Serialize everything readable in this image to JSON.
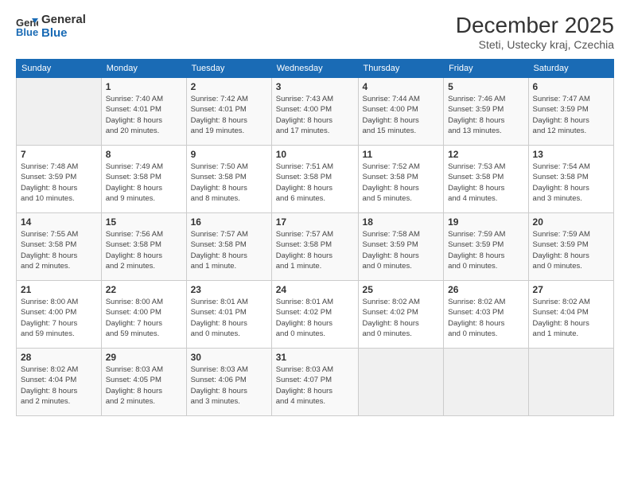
{
  "header": {
    "logo_line1": "General",
    "logo_line2": "Blue",
    "month_title": "December 2025",
    "location": "Steti, Ustecky kraj, Czechia"
  },
  "days_of_week": [
    "Sunday",
    "Monday",
    "Tuesday",
    "Wednesday",
    "Thursday",
    "Friday",
    "Saturday"
  ],
  "weeks": [
    [
      {
        "day": "",
        "detail": ""
      },
      {
        "day": "1",
        "detail": "Sunrise: 7:40 AM\nSunset: 4:01 PM\nDaylight: 8 hours\nand 20 minutes."
      },
      {
        "day": "2",
        "detail": "Sunrise: 7:42 AM\nSunset: 4:01 PM\nDaylight: 8 hours\nand 19 minutes."
      },
      {
        "day": "3",
        "detail": "Sunrise: 7:43 AM\nSunset: 4:00 PM\nDaylight: 8 hours\nand 17 minutes."
      },
      {
        "day": "4",
        "detail": "Sunrise: 7:44 AM\nSunset: 4:00 PM\nDaylight: 8 hours\nand 15 minutes."
      },
      {
        "day": "5",
        "detail": "Sunrise: 7:46 AM\nSunset: 3:59 PM\nDaylight: 8 hours\nand 13 minutes."
      },
      {
        "day": "6",
        "detail": "Sunrise: 7:47 AM\nSunset: 3:59 PM\nDaylight: 8 hours\nand 12 minutes."
      }
    ],
    [
      {
        "day": "7",
        "detail": "Sunrise: 7:48 AM\nSunset: 3:59 PM\nDaylight: 8 hours\nand 10 minutes."
      },
      {
        "day": "8",
        "detail": "Sunrise: 7:49 AM\nSunset: 3:58 PM\nDaylight: 8 hours\nand 9 minutes."
      },
      {
        "day": "9",
        "detail": "Sunrise: 7:50 AM\nSunset: 3:58 PM\nDaylight: 8 hours\nand 8 minutes."
      },
      {
        "day": "10",
        "detail": "Sunrise: 7:51 AM\nSunset: 3:58 PM\nDaylight: 8 hours\nand 6 minutes."
      },
      {
        "day": "11",
        "detail": "Sunrise: 7:52 AM\nSunset: 3:58 PM\nDaylight: 8 hours\nand 5 minutes."
      },
      {
        "day": "12",
        "detail": "Sunrise: 7:53 AM\nSunset: 3:58 PM\nDaylight: 8 hours\nand 4 minutes."
      },
      {
        "day": "13",
        "detail": "Sunrise: 7:54 AM\nSunset: 3:58 PM\nDaylight: 8 hours\nand 3 minutes."
      }
    ],
    [
      {
        "day": "14",
        "detail": "Sunrise: 7:55 AM\nSunset: 3:58 PM\nDaylight: 8 hours\nand 2 minutes."
      },
      {
        "day": "15",
        "detail": "Sunrise: 7:56 AM\nSunset: 3:58 PM\nDaylight: 8 hours\nand 2 minutes."
      },
      {
        "day": "16",
        "detail": "Sunrise: 7:57 AM\nSunset: 3:58 PM\nDaylight: 8 hours\nand 1 minute."
      },
      {
        "day": "17",
        "detail": "Sunrise: 7:57 AM\nSunset: 3:58 PM\nDaylight: 8 hours\nand 1 minute."
      },
      {
        "day": "18",
        "detail": "Sunrise: 7:58 AM\nSunset: 3:59 PM\nDaylight: 8 hours\nand 0 minutes."
      },
      {
        "day": "19",
        "detail": "Sunrise: 7:59 AM\nSunset: 3:59 PM\nDaylight: 8 hours\nand 0 minutes."
      },
      {
        "day": "20",
        "detail": "Sunrise: 7:59 AM\nSunset: 3:59 PM\nDaylight: 8 hours\nand 0 minutes."
      }
    ],
    [
      {
        "day": "21",
        "detail": "Sunrise: 8:00 AM\nSunset: 4:00 PM\nDaylight: 7 hours\nand 59 minutes."
      },
      {
        "day": "22",
        "detail": "Sunrise: 8:00 AM\nSunset: 4:00 PM\nDaylight: 7 hours\nand 59 minutes."
      },
      {
        "day": "23",
        "detail": "Sunrise: 8:01 AM\nSunset: 4:01 PM\nDaylight: 8 hours\nand 0 minutes."
      },
      {
        "day": "24",
        "detail": "Sunrise: 8:01 AM\nSunset: 4:02 PM\nDaylight: 8 hours\nand 0 minutes."
      },
      {
        "day": "25",
        "detail": "Sunrise: 8:02 AM\nSunset: 4:02 PM\nDaylight: 8 hours\nand 0 minutes."
      },
      {
        "day": "26",
        "detail": "Sunrise: 8:02 AM\nSunset: 4:03 PM\nDaylight: 8 hours\nand 0 minutes."
      },
      {
        "day": "27",
        "detail": "Sunrise: 8:02 AM\nSunset: 4:04 PM\nDaylight: 8 hours\nand 1 minute."
      }
    ],
    [
      {
        "day": "28",
        "detail": "Sunrise: 8:02 AM\nSunset: 4:04 PM\nDaylight: 8 hours\nand 2 minutes."
      },
      {
        "day": "29",
        "detail": "Sunrise: 8:03 AM\nSunset: 4:05 PM\nDaylight: 8 hours\nand 2 minutes."
      },
      {
        "day": "30",
        "detail": "Sunrise: 8:03 AM\nSunset: 4:06 PM\nDaylight: 8 hours\nand 3 minutes."
      },
      {
        "day": "31",
        "detail": "Sunrise: 8:03 AM\nSunset: 4:07 PM\nDaylight: 8 hours\nand 4 minutes."
      },
      {
        "day": "",
        "detail": ""
      },
      {
        "day": "",
        "detail": ""
      },
      {
        "day": "",
        "detail": ""
      }
    ]
  ]
}
